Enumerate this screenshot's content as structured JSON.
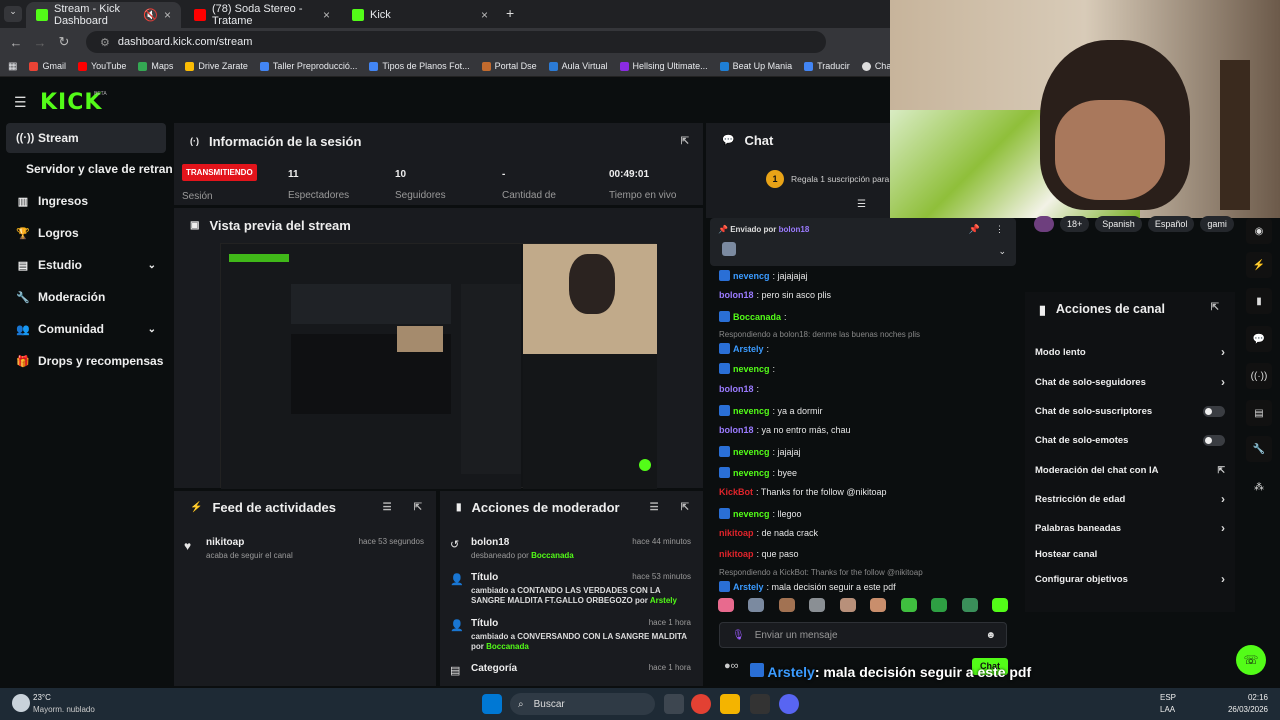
{
  "browser": {
    "tabs": [
      {
        "label": "Stream - Kick Dashboard",
        "active": true
      },
      {
        "label": "(78) Soda Stereo - Tratame"
      },
      {
        "label": "Kick"
      }
    ],
    "url": "dashboard.kick.com/stream",
    "bookmarks": [
      "Gmail",
      "YouTube",
      "Maps",
      "Drive Zarate",
      "Taller Preproducció...",
      "Tipos de Planos Fot...",
      "Portal Dse",
      "Aula Virtual",
      "Hellsing Ultimate...",
      "Beat Up Mania",
      "Traducir",
      "ChatGPT"
    ]
  },
  "app": {
    "logo": "KICK",
    "beta": "BETA"
  },
  "sidebar": {
    "items": [
      {
        "label": "Stream",
        "icon": "broadcast-icon"
      },
      {
        "label": "Servidor y clave de retransmisión"
      },
      {
        "label": "Ingresos",
        "icon": "chart-icon"
      },
      {
        "label": "Logros",
        "icon": "trophy-icon"
      },
      {
        "label": "Estudio",
        "icon": "grid-icon"
      },
      {
        "label": "Moderación",
        "icon": "wrench-icon"
      },
      {
        "label": "Comunidad",
        "icon": "people-icon"
      },
      {
        "label": "Drops y recompensas",
        "icon": "gift-icon"
      }
    ]
  },
  "session": {
    "title": "Información de la sesión",
    "status": "TRANSMITIENDO",
    "status_label": "Sesión",
    "stats": [
      {
        "value": "11",
        "label": "Espectadores"
      },
      {
        "value": "10",
        "label": "Seguidores"
      },
      {
        "value": "-",
        "label": "Cantidad de"
      },
      {
        "value": "00:49:01",
        "label": "Tiempo en vivo"
      }
    ]
  },
  "preview": {
    "title": "Vista previa del stream"
  },
  "feed": {
    "title": "Feed de actividades",
    "items": [
      {
        "user": "nikitoap",
        "text": "acaba de seguir el canal",
        "time": "hace 53 segundos"
      }
    ]
  },
  "mod": {
    "title": "Acciones de moderador",
    "items": [
      {
        "title": "bolon18",
        "sub": "desbaneado por",
        "by": "Boccanada",
        "time": "hace 44 minutos"
      },
      {
        "title": "Título",
        "sub": "cambiado a CONTANDO LAS VERDADES CON LA SANGRE MALDITA FT.GALLO ORBEGOZO por",
        "by": "Arstely",
        "time": "hace 53 minutos"
      },
      {
        "title": "Título",
        "sub": "cambiado a CONVERSANDO CON LA SANGRE MALDITA por",
        "by": "Boccanada",
        "time": "hace 1 hora"
      },
      {
        "title": "Categoría",
        "sub": "",
        "by": "",
        "time": "hace 1 hora"
      }
    ]
  },
  "chat": {
    "title": "Chat",
    "gift": "Regala 1 suscripción para",
    "gift_num": "1",
    "pinned": {
      "label": "Enviado por",
      "user": "bolon18"
    },
    "messages": [
      {
        "user": "nevencg",
        "text": ": jajajajaj",
        "color": "#3b9bff"
      },
      {
        "user": "bolon18",
        "text": ": pero sin asco plis",
        "color": "#9b7bff"
      },
      {
        "user": "Boccanada",
        "text": ":",
        "color": "#53fc18"
      },
      {
        "reply": "Respondiendo a bolon18: denme las buenas noches plis"
      },
      {
        "user": "Arstely",
        "text": ":",
        "color": "#3b9bff"
      },
      {
        "user": "nevencg",
        "text": ":",
        "color": "#53fc18"
      },
      {
        "user": "bolon18",
        "text": ":",
        "color": "#9b7bff"
      },
      {
        "user": "nevencg",
        "text": ": ya a dormir",
        "color": "#53fc18"
      },
      {
        "user": "bolon18",
        "text": ": ya no entro más, chau",
        "color": "#9b7bff"
      },
      {
        "user": "nevencg",
        "text": ": jajajaj",
        "color": "#53fc18"
      },
      {
        "user": "nevencg",
        "text": ": byee",
        "color": "#53fc18"
      },
      {
        "user": "KickBot",
        "text": ": Thanks for the follow @nikitoap",
        "color": "#e0242b"
      },
      {
        "user": "nevencg",
        "text": ": llegoo",
        "color": "#53fc18"
      },
      {
        "user": "nikitoap",
        "text": ": de nada crack",
        "color": "#e0242b"
      },
      {
        "user": "nikitoap",
        "text": ": que paso",
        "color": "#e0242b"
      },
      {
        "reply": "Respondiendo a KickBot: Thanks for the follow @nikitoap"
      },
      {
        "user": "Arstely",
        "text": ": mala decisión seguir a este pdf",
        "color": "#3b9bff"
      }
    ],
    "input_placeholder": "Enviar un mensaje",
    "send": "Chat",
    "overlay_user": "Arstely",
    "overlay_text": ": mala decisión seguir a este pdf"
  },
  "tags": [
    "18+",
    "Spanish",
    "Español",
    "gami"
  ],
  "channel_actions": {
    "title": "Acciones de canal",
    "items": [
      {
        "label": "Modo lento",
        "ctrl": "chevron"
      },
      {
        "label": "Chat de solo-seguidores",
        "ctrl": "chevron"
      },
      {
        "label": "Chat de solo-suscriptores",
        "ctrl": "toggle"
      },
      {
        "label": "Chat de solo-emotes",
        "ctrl": "toggle"
      },
      {
        "label": "Moderación del chat con IA",
        "ctrl": "ext"
      },
      {
        "label": "Restricción de edad",
        "ctrl": "chevron"
      },
      {
        "label": "Palabras baneadas",
        "ctrl": "chevron"
      },
      {
        "label": "Hostear canal",
        "ctrl": "none"
      },
      {
        "label": "Configurar objetivos",
        "ctrl": "chevron"
      }
    ]
  },
  "taskbar": {
    "weather_temp": "23°C",
    "weather_desc": "Mayorm. nublado",
    "search": "Buscar",
    "lang": "ESP",
    "lang2": "LAA",
    "time": "02:16",
    "date": "26/03/2026"
  },
  "colors": {
    "kick_green": "#53fc18",
    "live_red": "#e3141b",
    "bg": "#0b0e0f",
    "card": "#191b1f"
  }
}
